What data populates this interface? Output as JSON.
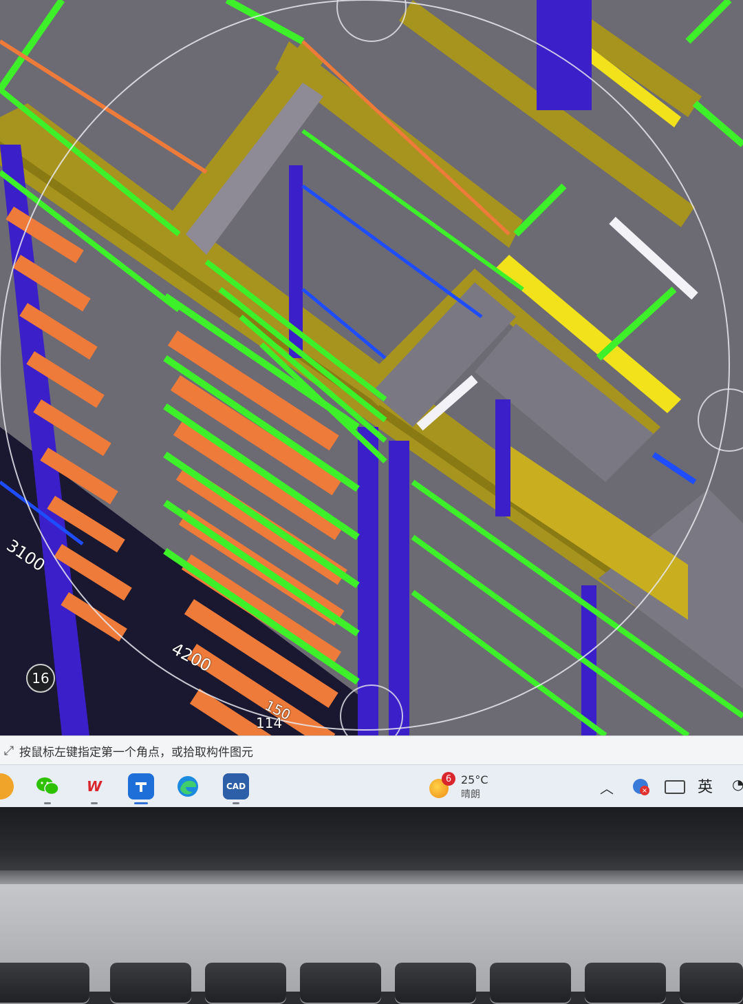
{
  "viewport": {
    "dimensions": {
      "d3100": "3100",
      "d4200": "4200",
      "d150": "150",
      "d114": "114"
    },
    "axis_marker": "16",
    "colors": {
      "beam": "#a7941e",
      "column": "#3b1fc9",
      "rebar_green": "#3df02a",
      "rebar_orange": "#ee7b3a",
      "slab": "#6c6a73",
      "yellow": "#f2e21b"
    }
  },
  "status_bar": {
    "icon": "arrow-diagonal-icon",
    "prompt": "按鼠标左键指定第一个角点，或拾取构件图元"
  },
  "taskbar": {
    "apps": [
      {
        "name": "orange-app-icon"
      },
      {
        "name": "wechat-icon"
      },
      {
        "name": "wps-icon",
        "label": "W"
      },
      {
        "name": "cad-app-icon"
      },
      {
        "name": "edge-icon"
      },
      {
        "name": "cad-icon"
      }
    ],
    "weather": {
      "badge": "6",
      "temp": "25°C",
      "desc": "晴朗"
    },
    "tray": {
      "chevron": "^",
      "ime": "英"
    }
  }
}
